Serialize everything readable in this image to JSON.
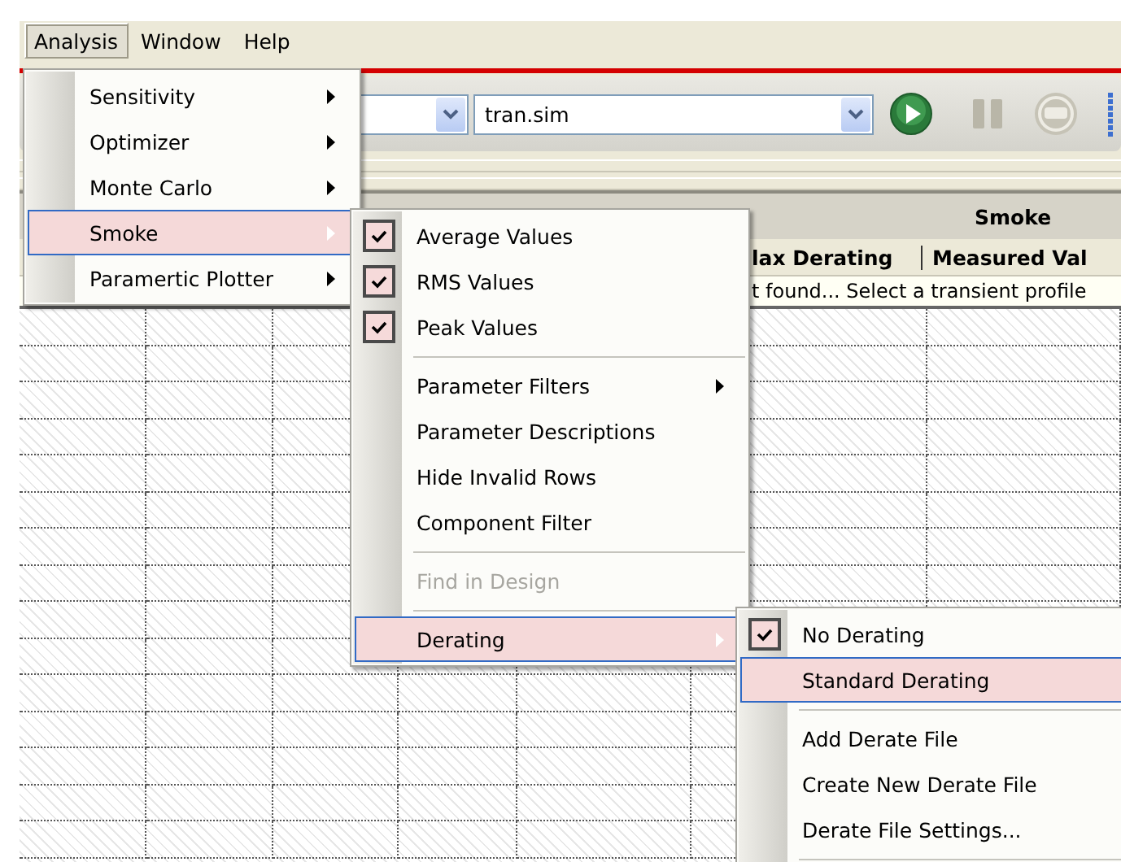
{
  "menubar": [
    {
      "label": "Analysis",
      "selected": true
    },
    {
      "label": "Window",
      "selected": false
    },
    {
      "label": "Help",
      "selected": false
    }
  ],
  "toolbar": {
    "file_dropdown": {
      "value": "tran.sim"
    }
  },
  "table": {
    "group_header": "Smoke",
    "columns": [
      "lax Derating",
      "Measured Val"
    ],
    "message": "t found...  Select a transient profile"
  },
  "analysis_menu": [
    {
      "kind": "item",
      "label": "Sensitivity",
      "submenu": true,
      "selected": false,
      "disabled": false
    },
    {
      "kind": "item",
      "label": "Optimizer",
      "submenu": true,
      "selected": false,
      "disabled": false
    },
    {
      "kind": "item",
      "label": "Monte Carlo",
      "submenu": true,
      "selected": false,
      "disabled": false
    },
    {
      "kind": "item",
      "label": "Smoke",
      "submenu": true,
      "selected": true,
      "disabled": false
    },
    {
      "kind": "item",
      "label": "Paramertic Plotter",
      "submenu": true,
      "selected": false,
      "disabled": false
    }
  ],
  "smoke_menu": [
    {
      "kind": "item",
      "label": "Average Values",
      "checked": true,
      "submenu": false,
      "selected": false,
      "disabled": false
    },
    {
      "kind": "item",
      "label": "RMS Values",
      "checked": true,
      "submenu": false,
      "selected": false,
      "disabled": false
    },
    {
      "kind": "item",
      "label": "Peak Values",
      "checked": true,
      "submenu": false,
      "selected": false,
      "disabled": false
    },
    {
      "kind": "separator"
    },
    {
      "kind": "item",
      "label": "Parameter Filters",
      "checked": false,
      "submenu": true,
      "selected": false,
      "disabled": false
    },
    {
      "kind": "item",
      "label": "Parameter Descriptions",
      "checked": false,
      "submenu": false,
      "selected": false,
      "disabled": false
    },
    {
      "kind": "item",
      "label": "Hide Invalid Rows",
      "checked": false,
      "submenu": false,
      "selected": false,
      "disabled": false
    },
    {
      "kind": "item",
      "label": "Component Filter",
      "checked": false,
      "submenu": false,
      "selected": false,
      "disabled": false
    },
    {
      "kind": "separator"
    },
    {
      "kind": "item",
      "label": "Find in Design",
      "checked": false,
      "submenu": false,
      "selected": false,
      "disabled": true
    },
    {
      "kind": "separator"
    },
    {
      "kind": "item",
      "label": "Derating",
      "checked": false,
      "submenu": true,
      "selected": true,
      "disabled": false
    }
  ],
  "derating_menu": [
    {
      "kind": "item",
      "label": "No Derating",
      "checked": true,
      "submenu": false,
      "selected": false,
      "disabled": false
    },
    {
      "kind": "item",
      "label": "Standard Derating",
      "checked": false,
      "submenu": false,
      "selected": true,
      "disabled": false
    },
    {
      "kind": "separator"
    },
    {
      "kind": "item",
      "label": "Add Derate File",
      "checked": false,
      "submenu": false,
      "selected": false,
      "disabled": false
    },
    {
      "kind": "item",
      "label": "Create New Derate File",
      "checked": false,
      "submenu": false,
      "selected": false,
      "disabled": false
    },
    {
      "kind": "item",
      "label": "Derate File Settings...",
      "checked": false,
      "submenu": false,
      "selected": false,
      "disabled": false
    },
    {
      "kind": "separator"
    }
  ]
}
